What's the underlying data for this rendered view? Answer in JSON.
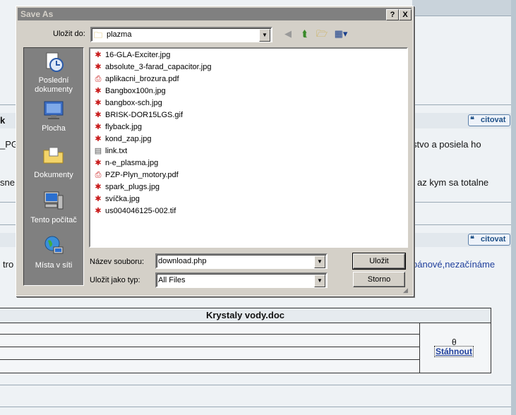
{
  "dialog": {
    "title": "Save As",
    "help_btn": "?",
    "close_btn": "X",
    "look_in_label": "Uložit do:",
    "look_in_value": "plazma",
    "places": [
      {
        "label": "Poslední dokumenty",
        "icon": "recent-documents-icon"
      },
      {
        "label": "Plocha",
        "icon": "desktop-icon"
      },
      {
        "label": "Dokumenty",
        "icon": "my-documents-folder-icon"
      },
      {
        "label": "Tento počítač",
        "icon": "my-computer-icon"
      },
      {
        "label": "Místa v síti",
        "icon": "network-places-icon"
      }
    ],
    "files": [
      {
        "name": "16-GLA-Exciter.jpg",
        "type": "image"
      },
      {
        "name": "absolute_3-farad_capacitor.jpg",
        "type": "image"
      },
      {
        "name": "aplikacni_brozura.pdf",
        "type": "pdf"
      },
      {
        "name": "Bangbox100n.jpg",
        "type": "image"
      },
      {
        "name": "bangbox-sch.jpg",
        "type": "image"
      },
      {
        "name": "BRISK-DOR15LGS.gif",
        "type": "image"
      },
      {
        "name": "flyback.jpg",
        "type": "image"
      },
      {
        "name": "kond_zap.jpg",
        "type": "image"
      },
      {
        "name": "link.txt",
        "type": "text"
      },
      {
        "name": "n-e_plasma.jpg",
        "type": "image"
      },
      {
        "name": "PZP-Plyn_motory.pdf",
        "type": "pdf"
      },
      {
        "name": "spark_plugs.jpg",
        "type": "image"
      },
      {
        "name": "svíčka.jpg",
        "type": "image"
      },
      {
        "name": "us004046125-002.tif",
        "type": "image"
      }
    ],
    "filename_label": "Název souboru:",
    "filename_value": "download.php",
    "filetype_label": "Uložit jako typ:",
    "filetype_value": "All Files",
    "save_btn": "Uložit",
    "cancel_btn": "Storno"
  },
  "background": {
    "frag_k": "k",
    "frag_pg": "_PG",
    "frag_sne": "sne",
    "frag_tro": "tro",
    "frag_posiela": "stvo a posiela ho",
    "frag_totalne": "az kym sa totalne",
    "frag_link": "pánové,nezačínáme",
    "citovat1": "citovat",
    "citovat2": "citovat",
    "attachment_name": "Krystaly vody.doc",
    "attachment_glyph": "θ",
    "download_link": "Stáhnout"
  },
  "colors": {
    "dialog_face": "#d4d0c8",
    "inactive_title": "#808080",
    "places_bar": "#808080",
    "link_blue": "#1f3f9c"
  }
}
